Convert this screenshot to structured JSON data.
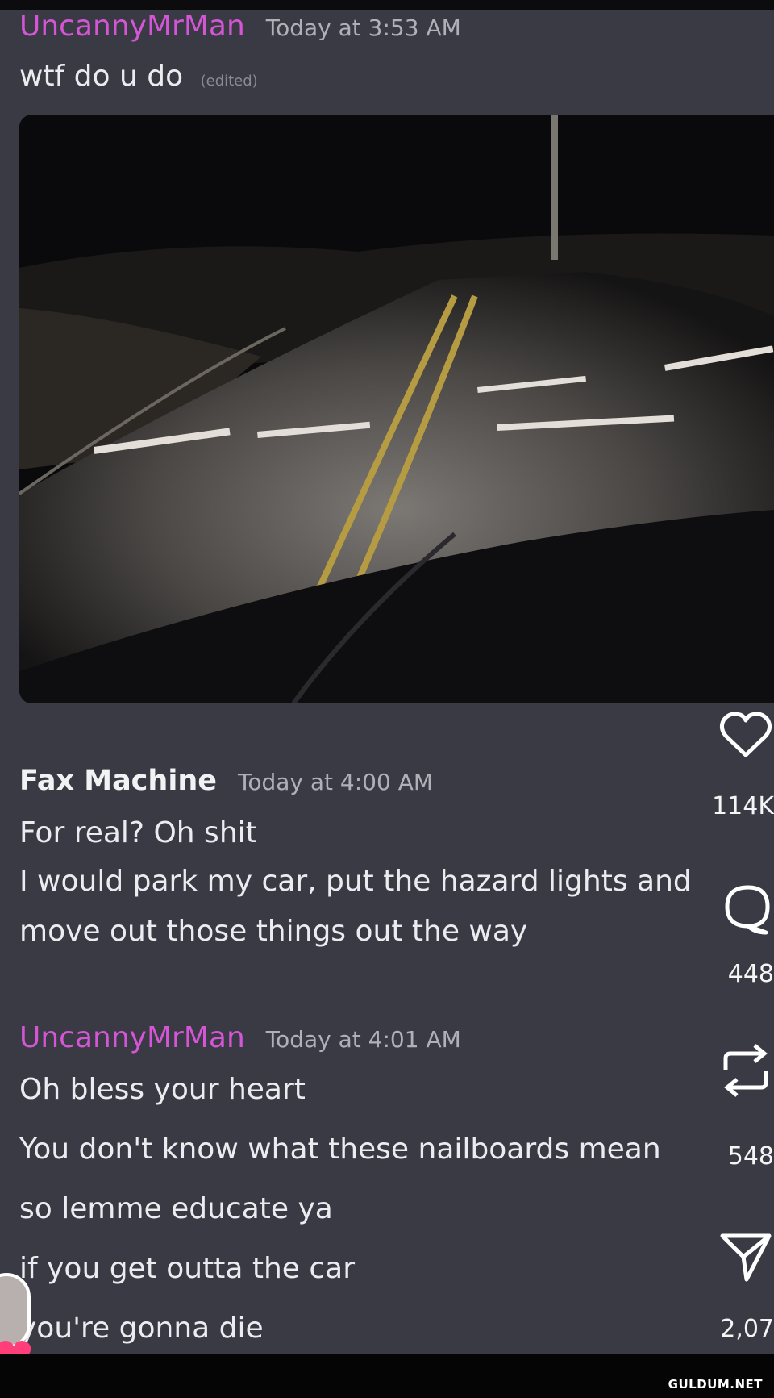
{
  "messages": [
    {
      "username": "UncannyMrMan",
      "timestamp": "Today at 3:53 AM",
      "lines": [
        "wtf do u do"
      ],
      "edited_label": "(edited)"
    },
    {
      "username": "Fax Machine",
      "timestamp": "Today at 4:00 AM",
      "lines": [
        "For real? Oh shit",
        "I would park my car, put the hazard lights and",
        "move out those things out the way"
      ]
    },
    {
      "username": "UncannyMrMan",
      "timestamp": "Today at 4:01 AM",
      "lines": [
        "Oh bless your heart",
        "You don't know what these nailboards mean",
        "so lemme educate ya",
        "if you get outta the car",
        "you're gonna die"
      ]
    }
  ],
  "attachment": {
    "description_icon": "night-road-nailboards-image"
  },
  "actions": {
    "like_count": "114K",
    "comment_count": "448",
    "repost_count": "548",
    "share_count": "2,07"
  },
  "watermark": "GULDUM.NET",
  "colors": {
    "username_accent": "#d456d6",
    "background": "#393a43",
    "like_badge": "#ff3e7a"
  }
}
